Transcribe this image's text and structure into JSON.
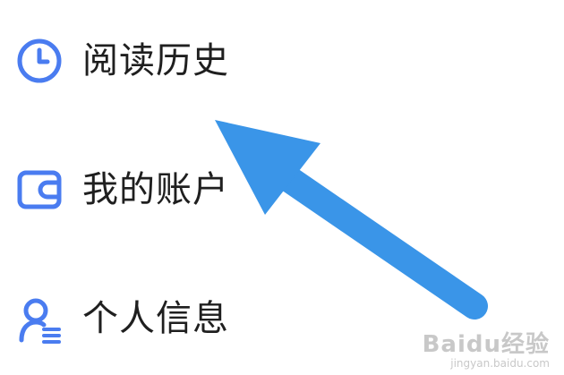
{
  "menu": {
    "items": [
      {
        "label": "阅读历史",
        "icon": "clock-icon"
      },
      {
        "label": "我的账户",
        "icon": "wallet-icon"
      },
      {
        "label": "个人信息",
        "icon": "profile-icon"
      }
    ]
  },
  "annotation": {
    "icon": "arrow-icon",
    "color": "#3a95e8"
  },
  "watermark": {
    "main": "Baidu经验",
    "sub": "jingyan.baidu.com"
  },
  "colors": {
    "icon_blue": "#4a7cf0",
    "text": "#1f1f1f"
  }
}
